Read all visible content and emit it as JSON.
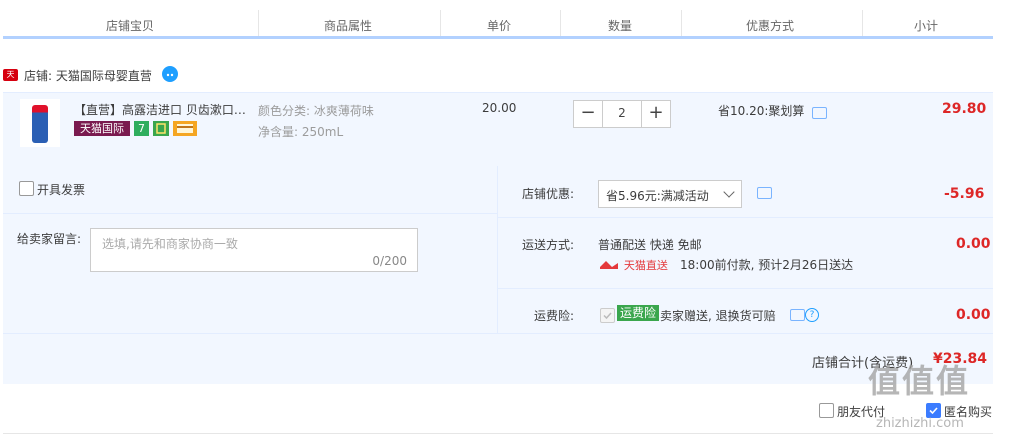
{
  "header": {
    "cols": [
      "店铺宝贝",
      "商品属性",
      "单价",
      "数量",
      "优惠方式",
      "小计"
    ]
  },
  "shop": {
    "badge": "天猫",
    "label": "店铺: 天猫国际母婴直营"
  },
  "item": {
    "title": "【直营】高露洁进口 贝齿漱口…",
    "tag_brand": "天猫国际",
    "tag_seven": "7",
    "attr_color": "颜色分类: 冰爽薄荷味",
    "attr_volume": "净含量: 250mL",
    "unit_price": "20.00",
    "quantity": "2",
    "minus": "−",
    "plus": "+",
    "discount": "省10.20:聚划算",
    "subtotal": "29.80"
  },
  "invoice": {
    "label": "开具发票"
  },
  "message": {
    "label": "给卖家留言:",
    "placeholder": "选填,请先和商家协商一致",
    "counter": "0/200"
  },
  "shop_discount": {
    "label": "店铺优惠:",
    "selected": "省5.96元:满减活动",
    "amount": "-5.96"
  },
  "shipping": {
    "label": "运送方式:",
    "method": "普通配送 快递 免邮",
    "badge": "天猫直送",
    "note": "18:00前付款, 预计2月26日送达",
    "amount": "0.00"
  },
  "insurance": {
    "label": "运费险:",
    "badge": "运费险",
    "note": "卖家赠送, 退换货可赔",
    "amount": "0.00"
  },
  "total": {
    "label": "店铺合计(含运费)",
    "amount": "¥23.84"
  },
  "options": {
    "friend_pay": "朋友代付",
    "anonymous": "匿名购买"
  },
  "watermark": {
    "logo": "值值值",
    "url": "zhizhizhi.com"
  },
  "colors": {
    "accent_red": "#dd2727",
    "panel_bg": "#f2f7ff",
    "header_line": "#b2d1ff",
    "tmall_red": "#d6000f",
    "insurance_green": "#3aa64d"
  }
}
